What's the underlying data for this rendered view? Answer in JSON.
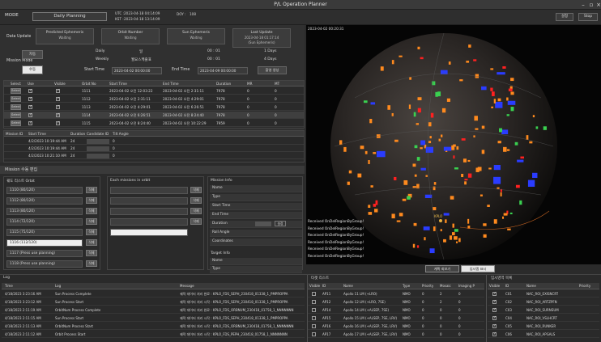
{
  "titlebar": {
    "title": "P/L Operation Planner"
  },
  "topbar": {
    "mode_label": "MODE",
    "mode_value": "Daily Planning",
    "utc_label": "UTC :",
    "utc_value": "2023-04-18 04:14:09",
    "kst_label": "KST :",
    "kst_value": "2023-04-18 13:14:09",
    "doy_label": "DOY :",
    "doy_value": "108",
    "btn_setting": "설정",
    "btn_stop": "Stop"
  },
  "data_update": {
    "label": "Data Update",
    "boxes": [
      {
        "title": "Predicted Ephemeris",
        "value": "Waiting"
      },
      {
        "title": "Orbit Number",
        "value": "Waiting"
      },
      {
        "title": "Sun Ephemeris",
        "value": "Waiting"
      },
      {
        "title": "Last Update",
        "value": "2023-04-18 01:17:14",
        "extra": "(Sun Ephemeris)"
      }
    ]
  },
  "mission_mode": {
    "label": "Mission Mode",
    "btn_auto": "자동",
    "btn_manual": "수동",
    "rows": [
      {
        "name": "Daily",
        "unit": "일",
        "time": "00 : 01",
        "period": "1 Days"
      },
      {
        "name": "Weekly",
        "unit": "월요스케줄표",
        "time": "00 : 01",
        "period": "4 Days"
      }
    ],
    "start_label": "Start Time",
    "start_value": "2023-04-02 00:00:00",
    "end_label": "End Time",
    "end_value": "2023-04-09 00:00:00",
    "btn_apply": "촬영 생성"
  },
  "grid1": {
    "headers": [
      "Select",
      "Use",
      "Visible",
      "Orbit No",
      "Start Time",
      "End Time",
      "Duration",
      "MR",
      "MT"
    ],
    "rows": [
      {
        "btn": "Select",
        "use": true,
        "visible": true,
        "orbit": "1111",
        "start": "2023-04-02 오전 12:03:22",
        "end": "2023-04-02 오전 2:31:11",
        "duration": "7978",
        "mr": "0",
        "mt": "0",
        "sel": false
      },
      {
        "btn": "Select",
        "use": true,
        "visible": true,
        "orbit": "1112",
        "start": "2023-04-02 오전 2:31:11",
        "end": "2023-04-02 오전 4:29:01",
        "duration": "7978",
        "mr": "0",
        "mt": "0",
        "sel": false
      },
      {
        "btn": "Select",
        "use": true,
        "visible": true,
        "orbit": "1113",
        "start": "2023-04-02 오전 4:29:01",
        "end": "2023-04-02 오전 6:26:51",
        "duration": "7978",
        "mr": "0",
        "mt": "0",
        "sel": false
      },
      {
        "btn": "Select",
        "use": true,
        "visible": true,
        "orbit": "1114",
        "start": "2023-04-02 오전 6:26:51",
        "end": "2023-04-02 오전 8:24:40",
        "duration": "7978",
        "mr": "0",
        "mt": "0",
        "sel": true
      },
      {
        "btn": "Select",
        "use": true,
        "visible": true,
        "orbit": "1115",
        "start": "2023-04-02 오전 8:24:40",
        "end": "2023-04-02 오전 10:22:29",
        "duration": "7959",
        "mr": "0",
        "mt": "0",
        "sel": false
      }
    ]
  },
  "grid2": {
    "headers": [
      "Mission ID",
      "Start Time",
      "Duration",
      "Candidate ID",
      "Tilt Angle"
    ],
    "rows": [
      {
        "start": "4/2/2023 10:19:44 AM",
        "duration": "24",
        "cand": "",
        "tilt": "0"
      },
      {
        "start": "4/2/2023 10:19:44 AM",
        "duration": "24",
        "cand": "",
        "tilt": "0"
      },
      {
        "start": "4/2/2023 10:21:10 AM",
        "duration": "24",
        "cand": "",
        "tilt": "0"
      }
    ]
  },
  "mission_edit": {
    "title": "Mission 수동 편집",
    "orbit_panel_title": "궤도 리스트 Orbit",
    "orbits": [
      {
        "label": "1110 (80/120)",
        "sel": false
      },
      {
        "label": "1112 (80/120)",
        "sel": false
      },
      {
        "label": "1113 (80/120)",
        "sel": false
      },
      {
        "label": "1114 (72/120)",
        "sel": false
      },
      {
        "label": "1115 (75/120)",
        "sel": false
      },
      {
        "label": "1116 (112/120)",
        "sel": true
      },
      {
        "label": "1117 (Press use planning)",
        "sel": false
      },
      {
        "label": "1118 (Press use planning)",
        "sel": false
      }
    ],
    "del_label": "삭제",
    "mid_panel_title": "Each missions in orbit",
    "info_title": "Mission Info",
    "info_rows": [
      "Name",
      "Type",
      "Start Time",
      "End Time",
      "Duration",
      "Roll Angle",
      "Coordinates"
    ],
    "duration_btn": "설정",
    "target_title": "Target Info",
    "target_rows": [
      "Name",
      "Type"
    ]
  },
  "viewer": {
    "timestamp": "2023-04-02 00:20:31",
    "target_label": "KPLO",
    "logs": [
      "Received OnDelRegionByGroup!",
      "Received OnDelRegionByGroup!",
      "Received OnDelRegionByGroup!",
      "Received OnDelRegionByGroup!",
      "Received OnDelRegionByGroup!",
      "Received OnDelRegionByGroup!"
    ],
    "btn_left": "계획 회보기",
    "btn_right": "임시맵 표시"
  },
  "log_section": {
    "title": "Log",
    "headers": [
      "Time",
      "Log",
      "Message"
    ],
    "rows": [
      {
        "time": "4/18/2023 3:23:16 AM",
        "log": "Sun Process Complete",
        "msg": "궤적 데이터 처리 완료 : KPLO_FDS_SEPH_230418_01338_1_PMPROPPA"
      },
      {
        "time": "4/18/2023 3:23:12 AM",
        "log": "Sun Process Start",
        "msg": "궤적 데이터 처리 시작 : KPLO_FDS_SEPH_230418_01338_1_PMPROPPA"
      },
      {
        "time": "4/18/2023 2:11:19 AM",
        "log": "OrbitNum Process Complete",
        "msg": "궤적 데이터 처리 완료 : KPLO_FDS_ORBNUM_230418_01758_1_NNNNNNN"
      },
      {
        "time": "4/18/2023 2:11:15 AM",
        "log": "Sun Process Start",
        "msg": "궤적 데이터 처리 시작 : KPLO_FDS_SEPH_230418_01338_1_PMPROPPA"
      },
      {
        "time": "4/18/2023 2:11:13 AM",
        "log": "OrbitNum Process Start",
        "msg": "궤적 데이터 처리 시작 : KPLO_FDS_ORBNUM_230418_01758_1_NNNNNNN"
      },
      {
        "time": "4/18/2023 2:11:12 AM",
        "log": "Orbit Process Start",
        "msg": "궤적 데이터 처리 시작 : KPLO_FDS_PEPH_230418_01758_1_NNNNNNN"
      }
    ]
  },
  "target_section": {
    "title": "타겟 리스트",
    "headers": [
      "Visible",
      "ID",
      "Name",
      "Type",
      "Priority",
      "Mosaic",
      "Imaging P"
    ],
    "rows": [
      {
        "id": "AP11",
        "name": "Apollo 11 LM (+LRO)",
        "type": "NMO",
        "priority": "0",
        "mosaic": "2",
        "imaging": "0"
      },
      {
        "id": "AP12",
        "name": "Apollo 12 LM (+LRO, 7SE)",
        "type": "NMO",
        "priority": "0",
        "mosaic": "2",
        "imaging": "0"
      },
      {
        "id": "AP14",
        "name": "Apollo 14 LM (+ALSEP, 7SE)",
        "type": "NMO",
        "priority": "0",
        "mosaic": "0",
        "imaging": "0"
      },
      {
        "id": "AP15",
        "name": "Apollo 15 LM (+ALSEP, 7SE, LRV)",
        "type": "NMO",
        "priority": "0",
        "mosaic": "0",
        "imaging": "0"
      },
      {
        "id": "AP16",
        "name": "Apollo 16 LM (+ALSEP, 7SE, LRV)",
        "type": "NMO",
        "priority": "0",
        "mosaic": "0",
        "imaging": "0"
      },
      {
        "id": "AP17",
        "name": "Apollo 17 LM (+ALSEP, 7SE, LRV)",
        "type": "NMO",
        "priority": "0",
        "mosaic": "0",
        "imaging": "0"
      }
    ]
  },
  "region_section": {
    "title": "임시영역 목록",
    "headers": [
      "Visible",
      "ID",
      "Name",
      "Priority"
    ],
    "rows": [
      {
        "id": "C01",
        "name": "NAC_ROI_EXISNCRT"
      },
      {
        "id": "C02",
        "name": "NAC_ROI_ARTZPFN"
      },
      {
        "id": "C03",
        "name": "NAC_ROI_SURNSUM"
      },
      {
        "id": "C04",
        "name": "NAC_ROI_VSLHCRT"
      },
      {
        "id": "C05",
        "name": "NAC_ROI_RUNKER"
      },
      {
        "id": "C06",
        "name": "NAC_ROI_APGALS"
      }
    ]
  }
}
